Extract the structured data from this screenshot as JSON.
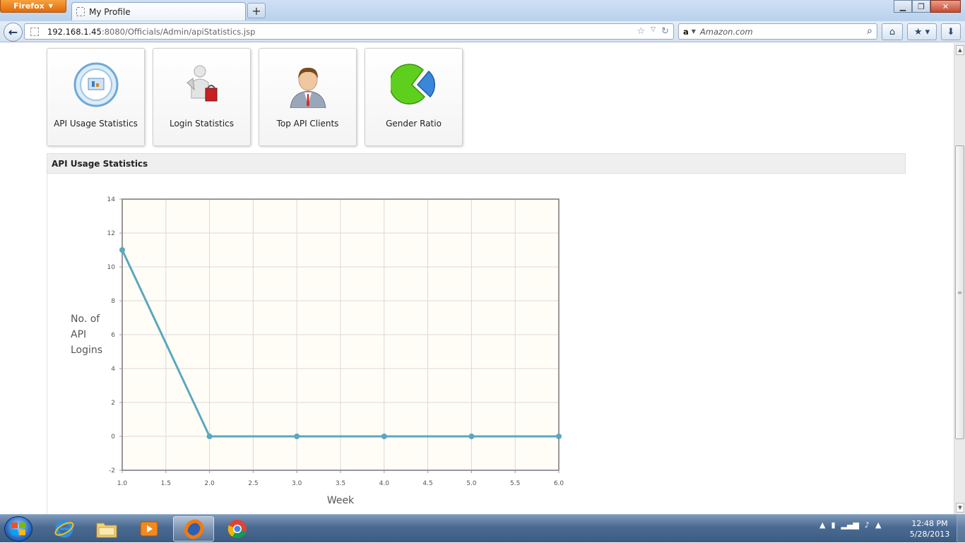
{
  "browser": {
    "menu_label": "Firefox",
    "tab_title": "My Profile",
    "new_tab_label": "+",
    "url_host": "192.168.1.45",
    "url_path": ":8080/Officials/Admin/apiStatistics.jsp",
    "search_engine": "a",
    "search_placeholder": "Amazon.com"
  },
  "tiles": [
    {
      "label": "API Usage Statistics",
      "icon": "api-usage-icon"
    },
    {
      "label": "Login Statistics",
      "icon": "login-statistics-icon"
    },
    {
      "label": "Top API Clients",
      "icon": "top-clients-icon"
    },
    {
      "label": "Gender Ratio",
      "icon": "pie-chart-icon"
    }
  ],
  "panel": {
    "title": "API Usage Statistics"
  },
  "chart_data": {
    "type": "line",
    "x": [
      1,
      2,
      3,
      4,
      5,
      6
    ],
    "series": [
      {
        "values": [
          11,
          0,
          0,
          0,
          0,
          0
        ]
      }
    ],
    "xlabel": "Week",
    "ylabel_lines": [
      "No. of",
      "API",
      "Logins"
    ],
    "xlim": [
      1,
      6
    ],
    "ylim": [
      -2,
      14
    ],
    "x_ticks": [
      "1.0",
      "1.5",
      "2.0",
      "2.5",
      "3.0",
      "3.5",
      "4.0",
      "4.5",
      "5.0",
      "5.5",
      "6.0"
    ],
    "y_ticks": [
      "-2",
      "0",
      "2",
      "4",
      "6",
      "8",
      "10",
      "12",
      "14"
    ],
    "grid": true,
    "line_color": "#5aa8bf",
    "plot_background": "#fffdf6"
  },
  "taskbar": {
    "time": "12:48 PM",
    "date": "5/28/2013"
  }
}
